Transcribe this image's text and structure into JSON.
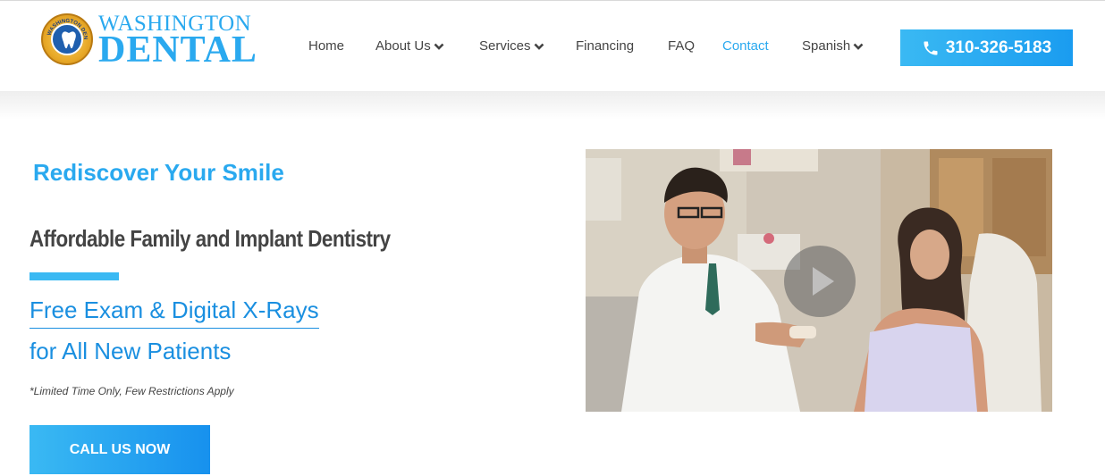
{
  "brand": {
    "name_top": "WASHINGTON",
    "name_bottom": "DENTAL",
    "seal_text": "WASHINGTON DENTAL",
    "color": "#2aa9ef"
  },
  "nav": {
    "items": [
      {
        "label": "Home",
        "dropdown": false,
        "active": false
      },
      {
        "label": "About Us",
        "dropdown": true,
        "active": false
      },
      {
        "label": "Services",
        "dropdown": true,
        "active": false
      },
      {
        "label": "Financing",
        "dropdown": false,
        "active": false
      },
      {
        "label": "FAQ",
        "dropdown": false,
        "active": false
      },
      {
        "label": "Contact",
        "dropdown": false,
        "active": true
      },
      {
        "label": "Spanish",
        "dropdown": true,
        "active": false
      }
    ],
    "phone_icon": "phone-icon",
    "phone": "310-326-5183"
  },
  "hero": {
    "kicker": "Rediscover Your Smile",
    "title": "Affordable Family and Implant Dentistry",
    "offer_line1": "Free Exam & Digital X-Rays",
    "offer_line2": "for All New Patients",
    "disclaimer": "*Limited Time Only, Few Restrictions Apply",
    "cta_label": "CALL US NOW"
  },
  "video": {
    "play_icon": "play-icon"
  },
  "colors": {
    "accent": "#2aa9ef",
    "offer_text": "#1a8fe0",
    "heading": "#444444"
  }
}
